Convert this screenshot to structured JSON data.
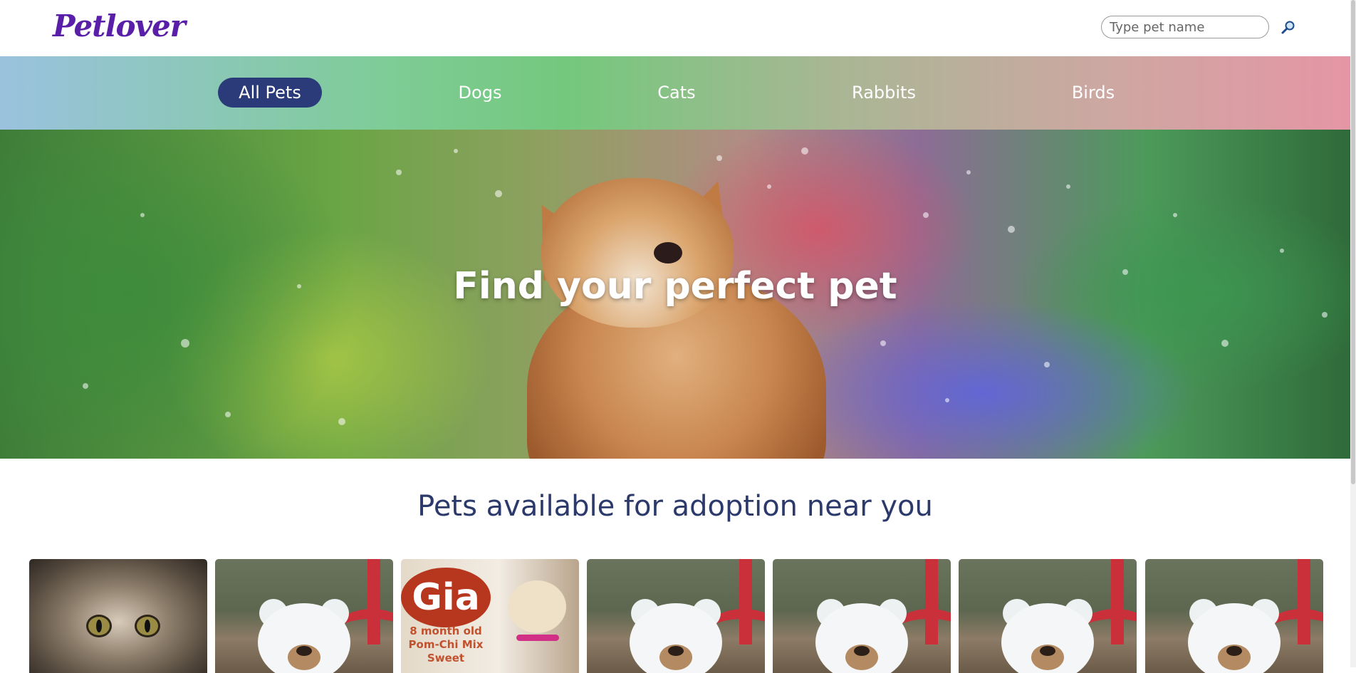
{
  "header": {
    "logo": "Petlover",
    "search": {
      "placeholder": "Type pet name",
      "value": ""
    },
    "search_icon": "magnifier-icon"
  },
  "nav": {
    "items": [
      {
        "label": "All Pets",
        "active": true
      },
      {
        "label": "Dogs",
        "active": false
      },
      {
        "label": "Cats",
        "active": false
      },
      {
        "label": "Rabbits",
        "active": false
      },
      {
        "label": "Birds",
        "active": false
      }
    ]
  },
  "hero": {
    "title": "Find your perfect pet"
  },
  "section": {
    "title": "Pets available for adoption near you"
  },
  "cards": [
    {
      "image": "cat"
    },
    {
      "image": "teddy-bear"
    },
    {
      "image": "gia-poster",
      "text": {
        "name": "Gia",
        "caption": "8 month old Pom-Chi Mix Sweet"
      }
    },
    {
      "image": "teddy-bear"
    },
    {
      "image": "teddy-bear"
    },
    {
      "image": "teddy-bear"
    },
    {
      "image": "teddy-bear"
    }
  ],
  "colors": {
    "logo": "#5a1fa8",
    "nav_active_bg": "#2b3a78",
    "title_text": "#2b3a6b"
  }
}
